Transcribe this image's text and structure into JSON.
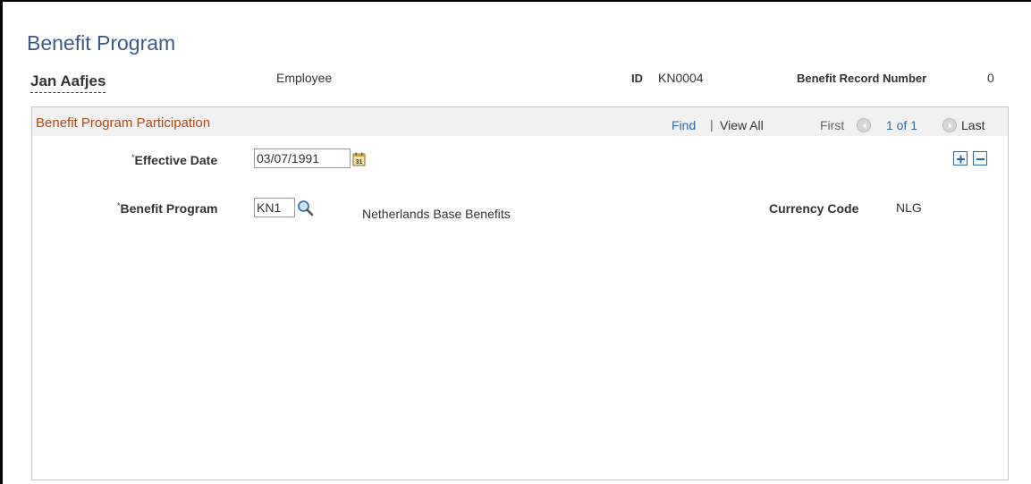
{
  "page": {
    "title": "Benefit Program"
  },
  "employee": {
    "name": "Jan Aafjes",
    "role": "Employee",
    "id_label": "ID",
    "id_value": "KN0004",
    "record_label": "Benefit Record Number",
    "record_value": "0"
  },
  "panel": {
    "title": "Benefit Program Participation",
    "nav": {
      "find": "Find",
      "separator": "|",
      "view_all": "View All",
      "first": "First",
      "count": "1 of 1",
      "last": "Last"
    }
  },
  "form": {
    "effective_date": {
      "required": "*",
      "label": "Effective Date",
      "value": "03/07/1991",
      "calendar_icon_text": "31"
    },
    "benefit_program": {
      "required": "*",
      "label": "Benefit Program",
      "value": "KN1",
      "description": "Netherlands Base Benefits"
    },
    "currency": {
      "label": "Currency Code",
      "value": "NLG"
    }
  },
  "colors": {
    "title_blue": "#3b5a8c",
    "section_orange": "#b24c10",
    "link_blue": "#2e6aa3"
  },
  "icons": {
    "calendar": "calendar-icon",
    "lookup": "magnifier-icon",
    "prev": "previous-arrow-icon",
    "next": "next-arrow-icon",
    "add_row": "plus-icon",
    "delete_row": "minus-icon"
  }
}
